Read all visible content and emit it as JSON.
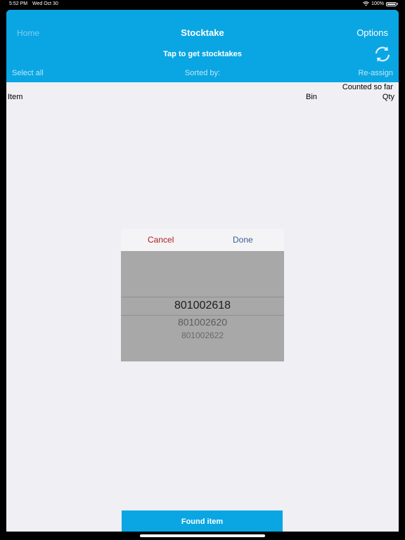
{
  "status_bar": {
    "time": "5:52 PM",
    "date": "Wed Oct 30",
    "battery": "100%",
    "icons": [
      "wifi-icon",
      "battery-icon"
    ]
  },
  "header": {
    "home_label": "Home",
    "title": "Stocktake",
    "options_label": "Options",
    "subtitle": "Tap to get stocktakes",
    "refresh_icon": "refresh-icon",
    "select_all_label": "Select all",
    "sorted_by_label": "Sorted by:",
    "reassign_label": "Re-assign"
  },
  "columns": {
    "counted_label": "Counted so far",
    "item_label": "Item",
    "bin_label": "Bin",
    "qty_label": "Qty"
  },
  "picker": {
    "cancel_label": "Cancel",
    "done_label": "Done",
    "selected_value": "801002618",
    "next_values": [
      "801002620",
      "801002622"
    ]
  },
  "footer": {
    "found_item_label": "Found item"
  },
  "colors": {
    "accent": "#0aa6e3",
    "cancel": "#b0191e",
    "done": "#3a5f95",
    "background": "#efeff4"
  }
}
